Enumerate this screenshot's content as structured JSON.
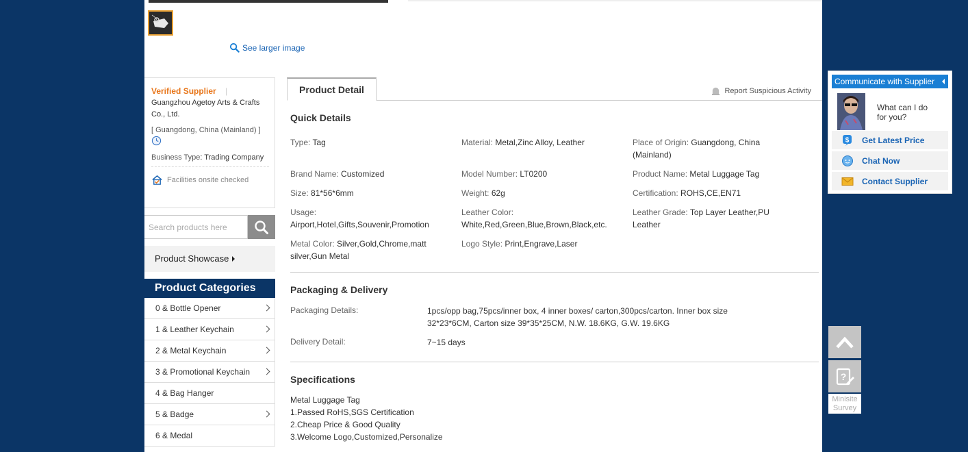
{
  "gallery": {
    "see_larger": "See larger image"
  },
  "supplier": {
    "verified": "Verified Supplier",
    "separator": "|",
    "company": "Guangzhou Agetoy Arts & Crafts Co., Ltd.",
    "location": "[ Guangdong, China (Mainland) ]",
    "business_type_key": "Business Type",
    "business_type_value": ": Trading Company",
    "onsite": "Facilities onsite checked"
  },
  "search": {
    "placeholder": "Search products here"
  },
  "showcase": {
    "label": "Product Showcase"
  },
  "categories": {
    "title": "Product Categories",
    "items": [
      {
        "label": "0 & Bottle Opener",
        "has_arrow": true
      },
      {
        "label": "1 & Leather Keychain",
        "has_arrow": true
      },
      {
        "label": "2 & Metal Keychain",
        "has_arrow": true
      },
      {
        "label": "3 & Promotional Keychain",
        "has_arrow": true
      },
      {
        "label": "4 & Bag Hanger",
        "has_arrow": false
      },
      {
        "label": "5 & Badge",
        "has_arrow": true
      },
      {
        "label": "6 & Medal",
        "has_arrow": false
      }
    ]
  },
  "detail": {
    "tab": "Product Detail",
    "report": "Report Suspicious Activity",
    "quick_title": "Quick Details",
    "quick": [
      {
        "k": "Type:",
        "v": "Tag"
      },
      {
        "k": "Material:",
        "v": "Metal,Zinc Alloy, Leather"
      },
      {
        "k": "Place of Origin:",
        "v": "Guangdong, China (Mainland)"
      },
      {
        "k": "Brand Name:",
        "v": "Customized"
      },
      {
        "k": "Model Number:",
        "v": "LT0200"
      },
      {
        "k": "Product Name:",
        "v": "Metal Luggage Tag"
      },
      {
        "k": "Size:",
        "v": "81*56*6mm"
      },
      {
        "k": "Weight:",
        "v": "62g"
      },
      {
        "k": "Certification:",
        "v": "ROHS,CE,EN71"
      },
      {
        "k": "Usage:",
        "v": "Airport,Hotel,Gifts,Souvenir,Promotion"
      },
      {
        "k": "Leather Color:",
        "v": "White,Red,Green,Blue,Brown,Black,etc."
      },
      {
        "k": "Leather Grade:",
        "v": "Top Layer Leather,PU Leather"
      },
      {
        "k": "Metal Color:",
        "v": "Silver,Gold,Chrome,matt silver,Gun Metal"
      },
      {
        "k": "Logo Style:",
        "v": "Print,Engrave,Laser"
      }
    ],
    "packaging_title": "Packaging & Delivery",
    "packaging_key": "Packaging Details:",
    "packaging_value": "1pcs/opp bag,75pcs/inner box, 4 inner boxes/ carton,300pcs/carton. Inner box size 32*23*6CM, Carton size 39*35*25CM, N.W. 18.6KG, G.W. 19.6KG",
    "delivery_key": "Delivery Detail:",
    "delivery_value": "7~15 days",
    "spec_title": "Specifications",
    "spec_lines": [
      "Metal Luggage Tag",
      "1.Passed RoHS,SGS Certification",
      "2.Cheap Price & Good Quality",
      "3.Welcome Logo,Customized,Personalize"
    ]
  },
  "communicate": {
    "title": "Communicate with Supplier",
    "question": "What can I do for you?",
    "price": "Get Latest Price",
    "chat": "Chat Now",
    "contact": "Contact Supplier"
  },
  "tools": {
    "survey": "Minisite Survey"
  }
}
